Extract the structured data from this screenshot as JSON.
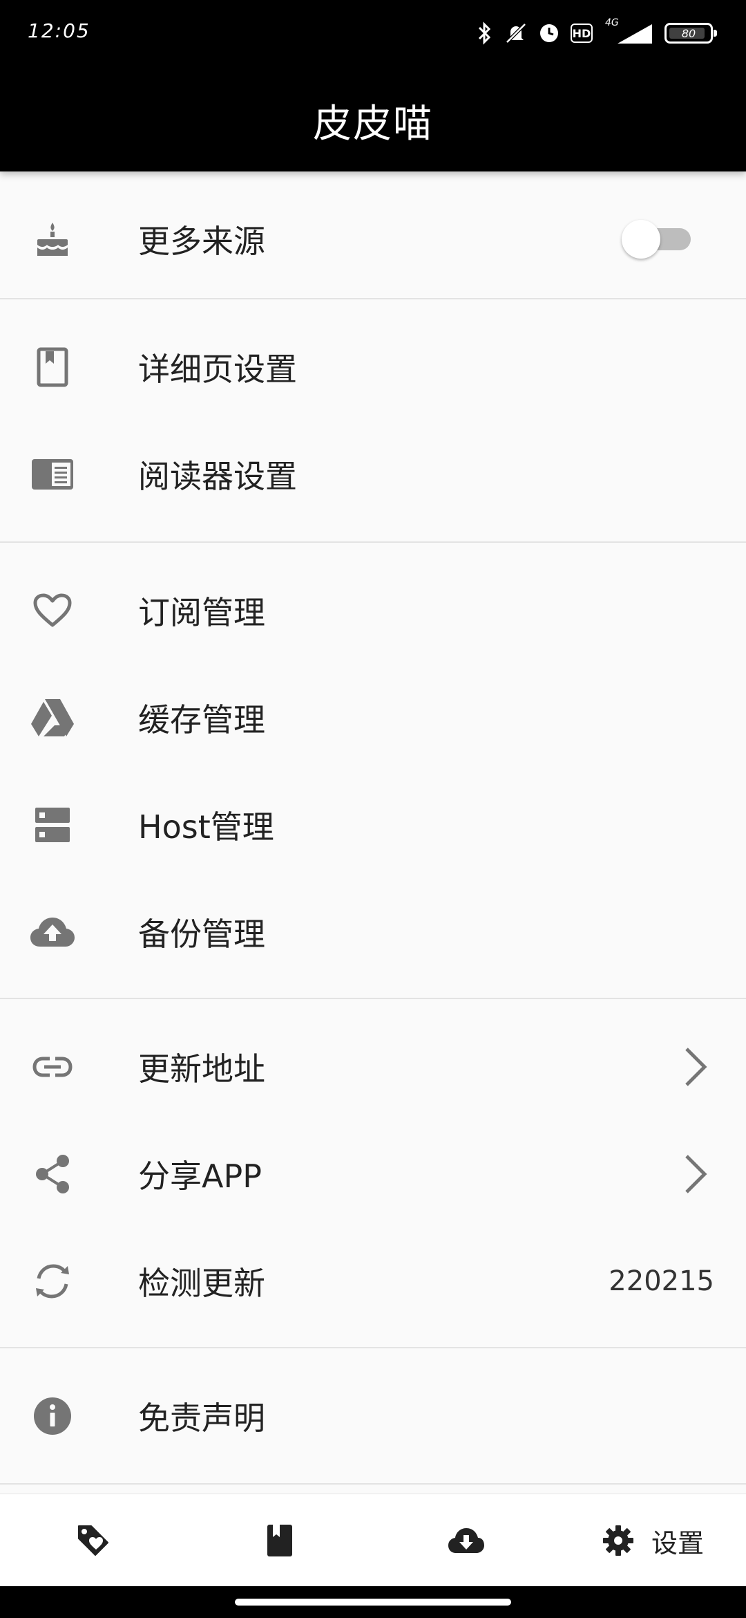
{
  "status_bar": {
    "time": "12:05",
    "battery": "80",
    "network": "4G",
    "hd": "HD"
  },
  "app_bar": {
    "title": "皮皮喵"
  },
  "settings": {
    "more_sources": {
      "label": "更多来源",
      "enabled": false
    },
    "detail_settings": {
      "label": "详细页设置"
    },
    "reader_settings": {
      "label": "阅读器设置"
    },
    "subscription_manage": {
      "label": "订阅管理"
    },
    "cache_manage": {
      "label": "缓存管理"
    },
    "host_manage": {
      "label": "Host管理"
    },
    "backup_manage": {
      "label": "备份管理"
    },
    "update_address": {
      "label": "更新地址"
    },
    "share_app": {
      "label": "分享APP"
    },
    "check_update": {
      "label": "检测更新",
      "value": "220215"
    },
    "disclaimer": {
      "label": "免责声明"
    }
  },
  "bottom_nav": {
    "items": [
      {
        "icon": "tag-heart-icon"
      },
      {
        "icon": "book-icon"
      },
      {
        "icon": "cloud-download-icon"
      },
      {
        "icon": "gear-icon",
        "label": "设置",
        "active": true
      }
    ]
  },
  "colors": {
    "app_bar_bg": "#000000",
    "background": "#fafafa",
    "icon": "#757575",
    "text": "#222222",
    "divider": "#e3e3e3"
  }
}
